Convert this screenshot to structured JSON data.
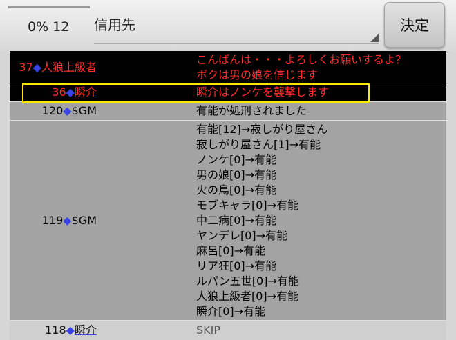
{
  "progress": {
    "text": "0% 12",
    "fraction": 0.0
  },
  "target": {
    "label": "信用先"
  },
  "decide_button": {
    "label": "決定"
  },
  "colors": {
    "accent_blue": "#3a43e6",
    "message_red": "#ff2a2a",
    "highlight_yellow": "#ffe600"
  },
  "log": [
    {
      "number": "37",
      "name": "人狼上級者",
      "lines": [
        "こんばんは・・・よろしくお願いするよ？",
        "ボクは男の娘を信じます"
      ]
    },
    {
      "number": "36",
      "name": "瞬介",
      "lines": [
        "瞬介はノンケを襲撃します"
      ]
    },
    {
      "number": "120",
      "name": "$GM",
      "lines": [
        "有能が処刑されました"
      ]
    },
    {
      "number": "119",
      "name": "$GM",
      "lines": [
        "有能[12]→寂しがり屋さん",
        "寂しがり屋さん[1]→有能",
        "ノンケ[0]→有能",
        "男の娘[0]→有能",
        "火の鳥[0]→有能",
        "モブキャラ[0]→有能",
        "中二病[0]→有能",
        "ヤンデレ[0]→有能",
        "麻呂[0]→有能",
        "リア狂[0]→有能",
        "ルパン五世[0]→有能",
        "人狼上級者[0]→有能",
        "瞬介[0]→有能"
      ]
    },
    {
      "number": "118",
      "name": "瞬介",
      "lines": [
        "SKIP"
      ]
    }
  ]
}
